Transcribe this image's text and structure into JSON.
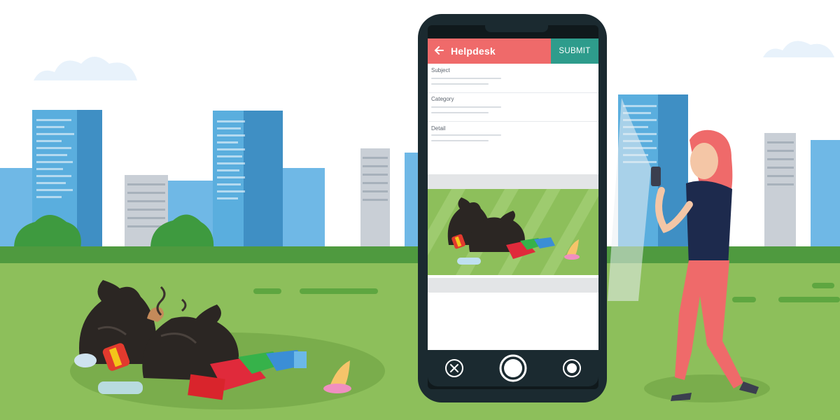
{
  "app": {
    "title": "Helpdesk",
    "submit_label": "SUBMIT"
  },
  "form": {
    "fields": [
      {
        "label": "Subject",
        "value": ""
      },
      {
        "label": "Category",
        "value": ""
      },
      {
        "label": "Detail",
        "value": ""
      }
    ]
  },
  "camera": {
    "left_icon": "close-circle-icon",
    "center_icon": "shutter-button-icon",
    "right_icon": "record-icon"
  },
  "colors": {
    "appbar": "#ef6a6a",
    "submit": "#2e9c8c",
    "grass": "#8dbf5b",
    "sky_building": "#5aaede",
    "phone_frame": "#1b2a30",
    "person_shirt": "#1d2a4d",
    "person_pants": "#ef6a6a"
  }
}
